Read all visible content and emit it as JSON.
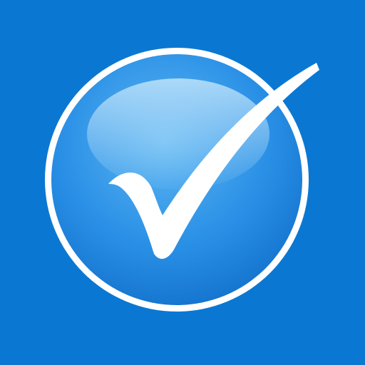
{
  "icon": {
    "name": "checkmark-icon",
    "colors": {
      "background": "#0A78D2",
      "ring": "#FFFFFF",
      "disc_light": "#5DB6F2",
      "disc_mid": "#2A90E6",
      "disc_dark": "#0E6CC8",
      "highlight": "#BFE3FB",
      "check": "#FFFFFF"
    }
  }
}
